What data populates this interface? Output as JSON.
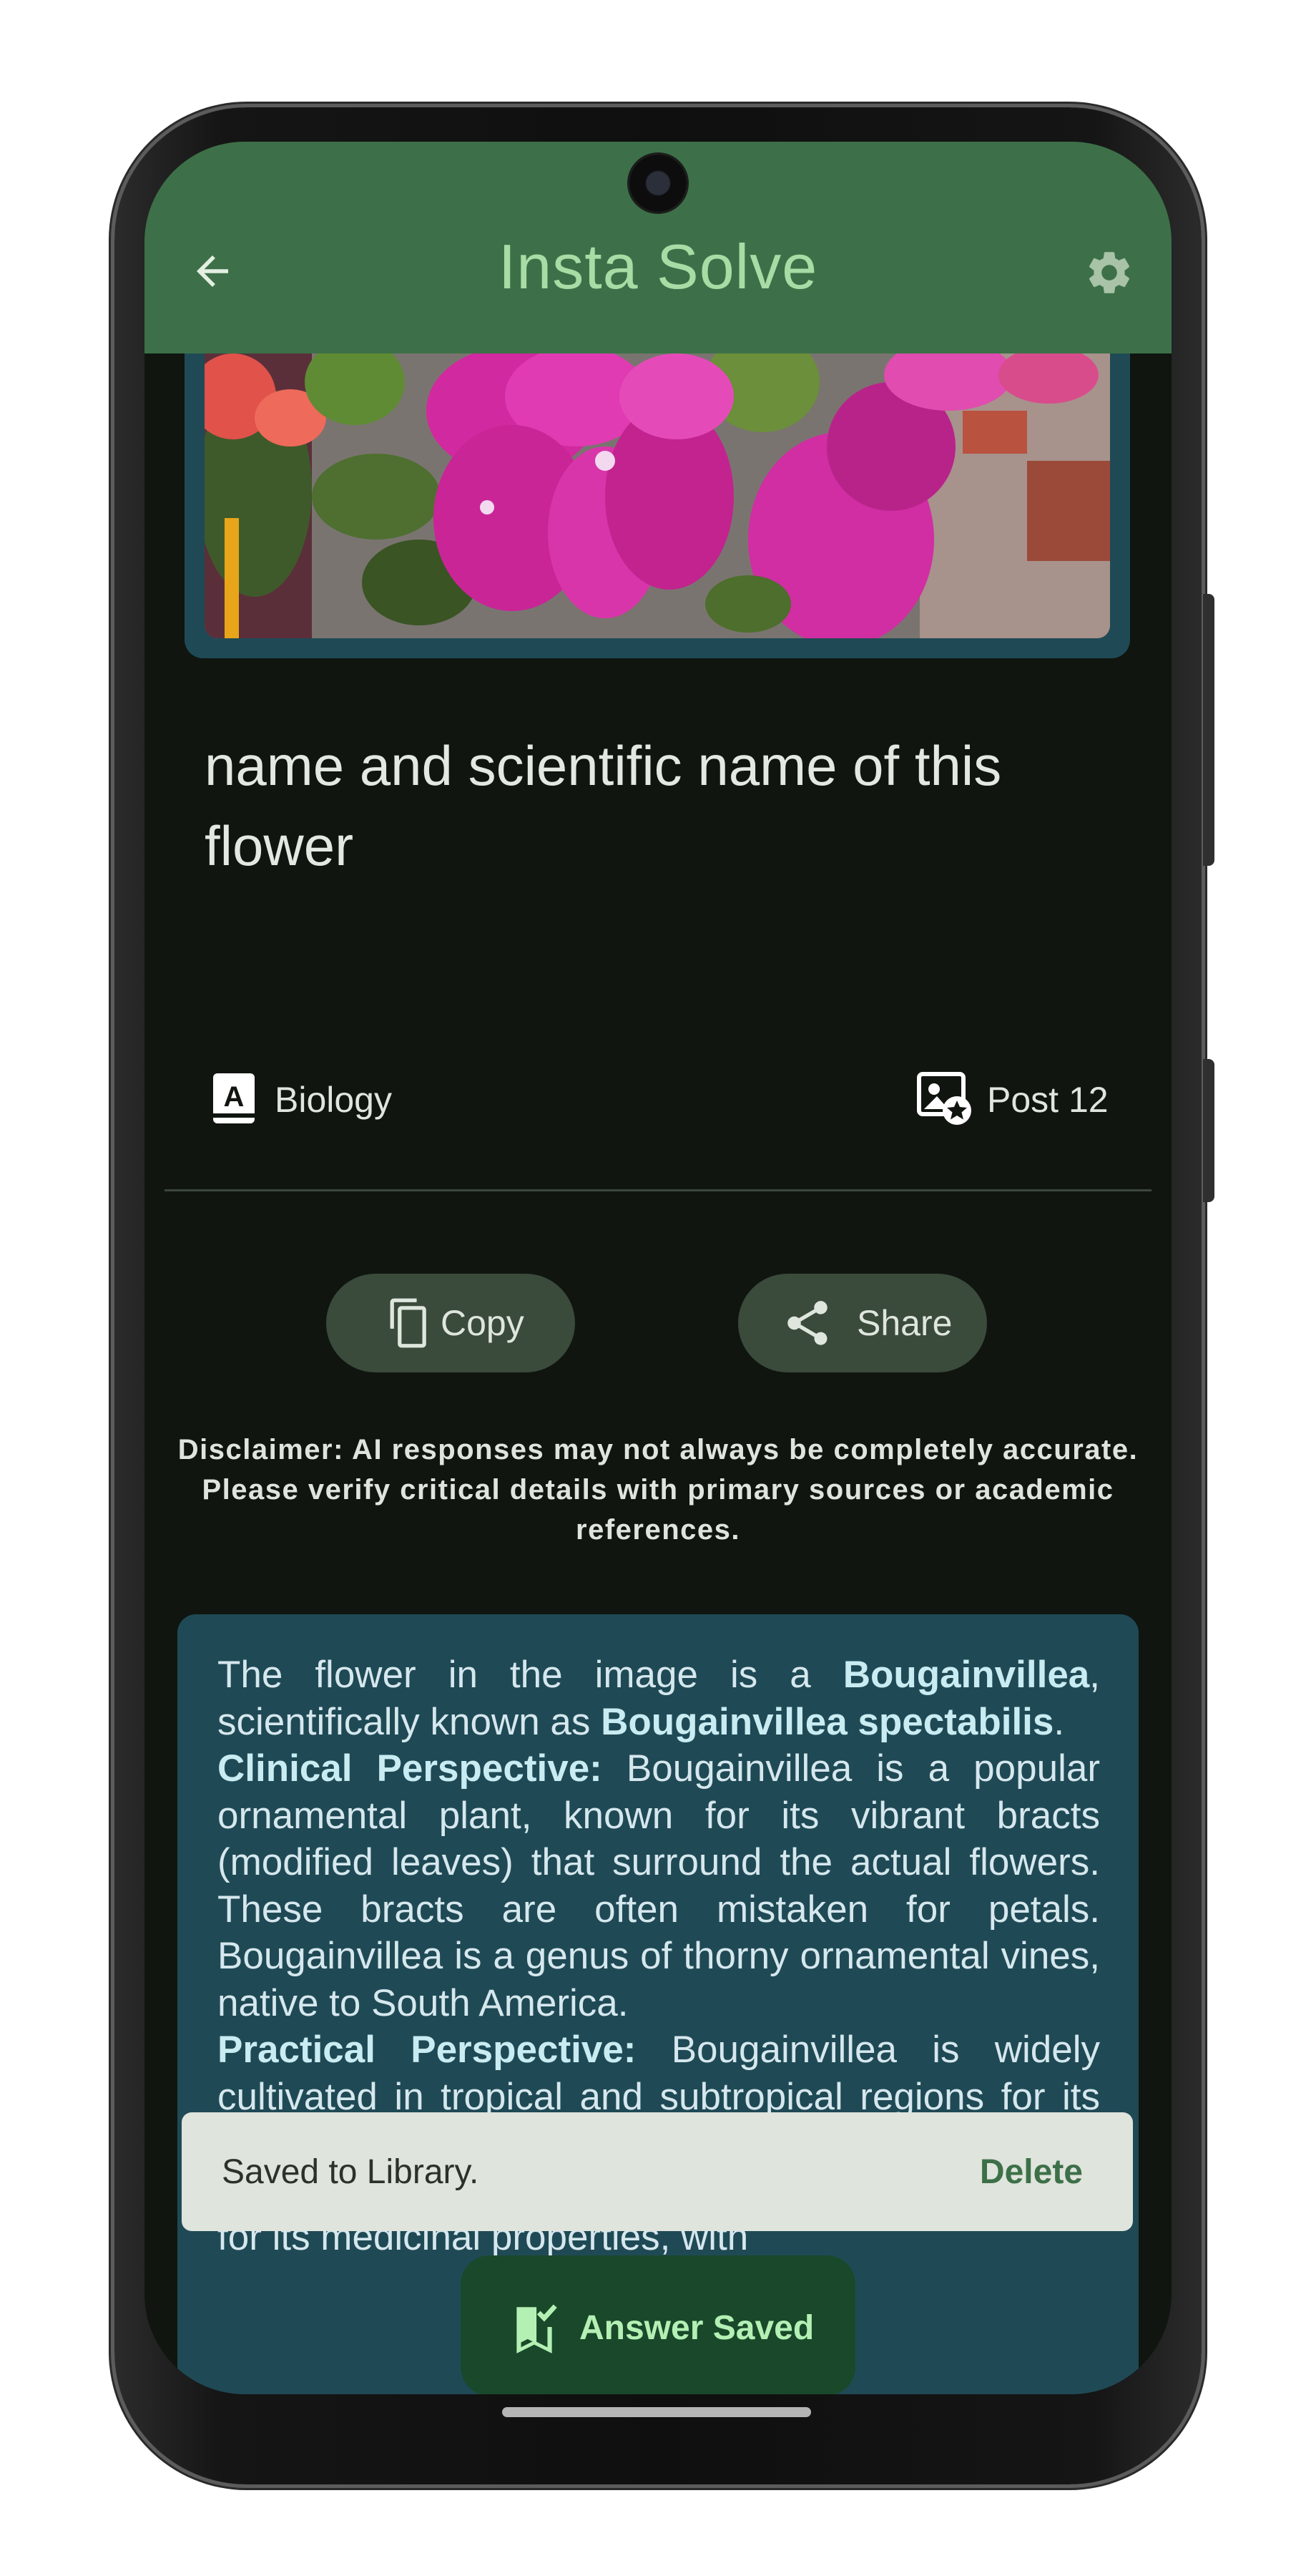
{
  "app_bar": {
    "title": "Insta Solve",
    "back_icon": "arrow-left-icon",
    "settings_icon": "gear-icon",
    "background_color": "#3d7048",
    "title_color": "#a9dba5"
  },
  "image": {
    "alt": "flower-photo",
    "dominant_colors": [
      "#d62fa8",
      "#6b8a3c",
      "#8a6f6a"
    ]
  },
  "question": {
    "text": "name and scientific name of this flower"
  },
  "meta": {
    "subject_icon": "book-letter-a-icon",
    "subject": "Biology",
    "post_icon": "image-star-icon",
    "post": "Post 12"
  },
  "actions": {
    "copy_icon": "copy-icon",
    "copy_label": "Copy",
    "share_icon": "share-icon",
    "share_label": "Share"
  },
  "disclaimer": {
    "line1": "Disclaimer: AI responses may not always be completely accurate.",
    "line2": "Please verify critical details with primary sources or academic",
    "line3": "references."
  },
  "answer": {
    "p1_a": "The flower in the image is a ",
    "p1_b": "Bougainvillea",
    "p1_c": ", scientifically known as ",
    "p1_d": "Bougainvillea spectabilis",
    "p1_e": ".",
    "p2_heading": "Clinical Perspective:",
    "p2_text": " Bougainvillea is a popular ornamental plant, known for its vibrant bracts (modified leaves) that surround the actual flowers. These bracts are often mistaken for petals. Bougainvillea is a genus of thorny ornamental vines, native to South America.",
    "p3_heading": "Practical Perspective:",
    "p3_text": " Bougainvillea is widely cultivated in tropical and subtropical regions for its showy bracts. It is a popular choice for landscaping, hedges, and trellises. Bougainvillea is also known for its medicinal properties, with"
  },
  "snackbar": {
    "message": "Saved to Library.",
    "action": "Delete"
  },
  "fab": {
    "icon": "bookmark-check-icon",
    "label": "Answer Saved"
  }
}
